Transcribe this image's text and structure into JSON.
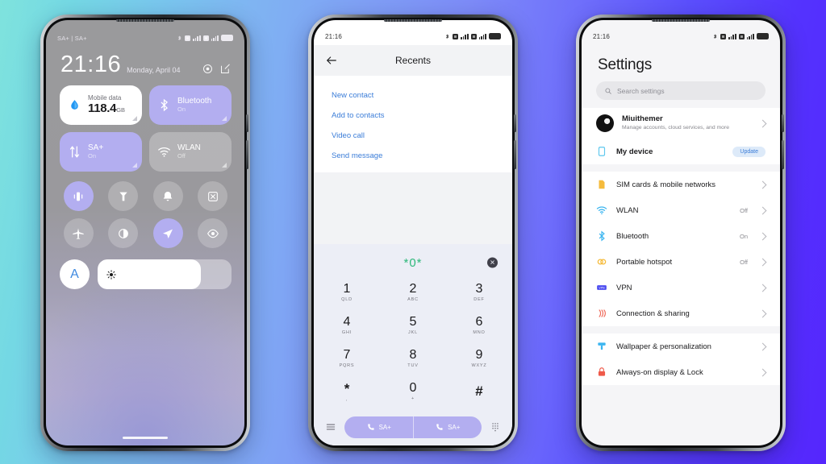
{
  "background": {
    "from": "#7fe3dd",
    "to": "#5526fd"
  },
  "phone1": {
    "name": "control-center",
    "statusbar": {
      "carrier": "SA+ | SA+",
      "icons": [
        "bluetooth-icon",
        "sim1-icon",
        "signal1-icon",
        "sim2-icon",
        "signal2-icon",
        "battery-icon"
      ]
    },
    "clock": {
      "time": "21:16",
      "date": "Monday, April 04"
    },
    "header_icons": [
      "settings-gear-icon",
      "edit-icon"
    ],
    "tiles": [
      {
        "id": "mobile-data",
        "title": "Mobile data",
        "value": "118.4",
        "unit": "GB",
        "state": "white",
        "icon": "data-drop-icon"
      },
      {
        "id": "bluetooth",
        "title": "Bluetooth",
        "sub": "On",
        "state": "on",
        "icon": "bluetooth-icon"
      },
      {
        "id": "data-network",
        "title": "SA+",
        "sub": "On",
        "state": "on",
        "icon": "data-arrows-icon"
      },
      {
        "id": "wlan",
        "title": "WLAN",
        "sub": "Off",
        "state": "off",
        "icon": "wifi-icon"
      }
    ],
    "toggles": [
      {
        "id": "vibrate",
        "icon": "vibrate-icon",
        "on": true
      },
      {
        "id": "flashlight",
        "icon": "flashlight-icon",
        "on": false
      },
      {
        "id": "ringer",
        "icon": "bell-icon",
        "on": false
      },
      {
        "id": "screenshot",
        "icon": "screenshot-icon",
        "on": false
      },
      {
        "id": "airplane",
        "icon": "airplane-icon",
        "on": false
      },
      {
        "id": "dark-mode",
        "icon": "contrast-icon",
        "on": false
      },
      {
        "id": "location",
        "icon": "location-arrow-icon",
        "on": true
      },
      {
        "id": "reading-mode",
        "icon": "eye-icon",
        "on": false
      }
    ],
    "brightness": {
      "auto_label": "A",
      "fill_percent": 77,
      "icon": "sun-icon"
    },
    "home_indicator": true
  },
  "phone2": {
    "name": "dialer",
    "statusbar": {
      "time": "21:16",
      "icons": [
        "bluetooth-icon",
        "sim1-icon",
        "signal1-icon",
        "sim2-icon",
        "signal2-icon",
        "battery-icon"
      ]
    },
    "header": {
      "back_icon": "arrow-left-icon",
      "title": "Recents"
    },
    "menu_items": [
      "New contact",
      "Add to contacts",
      "Video call",
      "Send message"
    ],
    "dial_input": {
      "number": "*0*",
      "clear_icon": "clear-circle-icon"
    },
    "keys": [
      {
        "num": "1",
        "sub": "QLD"
      },
      {
        "num": "2",
        "sub": "ABC"
      },
      {
        "num": "3",
        "sub": "DEF"
      },
      {
        "num": "4",
        "sub": "GHI"
      },
      {
        "num": "5",
        "sub": "JKL"
      },
      {
        "num": "6",
        "sub": "MNO"
      },
      {
        "num": "7",
        "sub": "PQRS"
      },
      {
        "num": "8",
        "sub": "TUV"
      },
      {
        "num": "9",
        "sub": "WXYZ"
      },
      {
        "num": "*",
        "sub": ","
      },
      {
        "num": "0",
        "sub": "+"
      },
      {
        "num": "#",
        "sub": ""
      }
    ],
    "actions": {
      "menu_icon": "hamburger-icon",
      "call_sim1_label": "SA+",
      "call_sim2_label": "SA+",
      "keypad_icon": "keypad-grid-icon"
    }
  },
  "phone3": {
    "name": "settings",
    "statusbar": {
      "time": "21:16",
      "icons": [
        "bluetooth-icon",
        "sim1-icon",
        "signal1-icon",
        "sim2-icon",
        "signal2-icon",
        "battery-icon"
      ]
    },
    "title": "Settings",
    "search": {
      "placeholder": "Search settings",
      "icon": "search-icon"
    },
    "account": {
      "name": "Miuithemer",
      "subtitle": "Manage accounts, cloud services, and more",
      "avatar": "profile-avatar"
    },
    "my_device": {
      "label": "My device",
      "badge": "Update",
      "icon": "device-icon",
      "icon_color": "#5fc8ee"
    },
    "rows": [
      {
        "label": "SIM cards & mobile networks",
        "value": "",
        "icon": "sim-card-icon",
        "color": "#f5bb3c"
      },
      {
        "label": "WLAN",
        "value": "Off",
        "icon": "wifi-icon",
        "color": "#3bb5f0"
      },
      {
        "label": "Bluetooth",
        "value": "On",
        "icon": "bluetooth-icon",
        "color": "#3bb5f0"
      },
      {
        "label": "Portable hotspot",
        "value": "Off",
        "icon": "hotspot-icon",
        "color": "#f5bb3c"
      },
      {
        "label": "VPN",
        "value": "",
        "icon": "vpn-icon",
        "color": "#4b4bf0"
      },
      {
        "label": "Connection & sharing",
        "value": "",
        "icon": "share-icon",
        "color": "#ef6a5a"
      }
    ],
    "rows2": [
      {
        "label": "Wallpaper & personalization",
        "value": "",
        "icon": "brush-icon",
        "color": "#3bb5f0"
      },
      {
        "label": "Always-on display & Lock",
        "value": "",
        "icon": "lock-icon",
        "color": "#ef5a4a"
      }
    ]
  }
}
